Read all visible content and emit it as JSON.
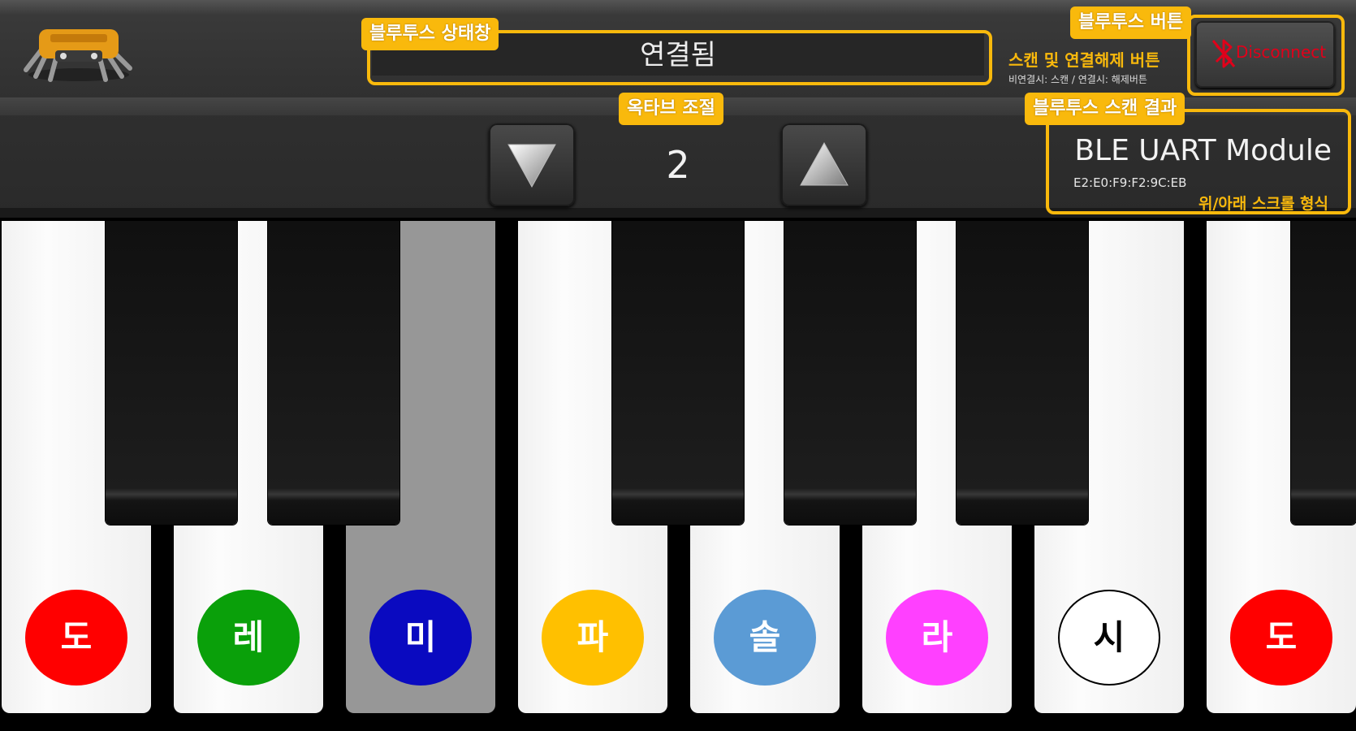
{
  "header": {
    "status_callout": "블루투스 상태창",
    "status_text": "연결됨",
    "octave_callout": "옥타브 조절",
    "octave_value": "2",
    "bt_button_callout": "블루투스 버튼",
    "bt_button_desc": "스캔 및 연결해제 버튼",
    "bt_button_sub": "비연결시: 스캔 / 연결시: 해제버튼",
    "bt_button_label": "Disconnect",
    "scan_callout": "블루투스 스캔 결과",
    "scan_device_name": "BLE UART Module",
    "scan_device_mac": "E2:E0:F9:F2:9C:EB",
    "scan_note": "위/아래 스크롤 형식"
  },
  "colors": {
    "callout": "#f9b90c",
    "disconnect_text": "#e0001a"
  },
  "keys": {
    "notes": [
      {
        "label": "도",
        "color": "#ff0000"
      },
      {
        "label": "레",
        "color": "#0aa00a"
      },
      {
        "label": "미",
        "color": "#0a0ac0"
      },
      {
        "label": "파",
        "color": "#ffc000"
      },
      {
        "label": "솔",
        "color": "#5b9bd5"
      },
      {
        "label": "라",
        "color": "#ff40ff"
      },
      {
        "label": "시",
        "color": "#ffffff"
      },
      {
        "label": "도",
        "color": "#ff0000"
      }
    ],
    "pressed_index": 2
  },
  "icons": {
    "logo": "robot-spider-logo",
    "octave_down": "triangle-down-icon",
    "octave_up": "triangle-up-icon",
    "bluetooth": "bluetooth-off-icon"
  }
}
